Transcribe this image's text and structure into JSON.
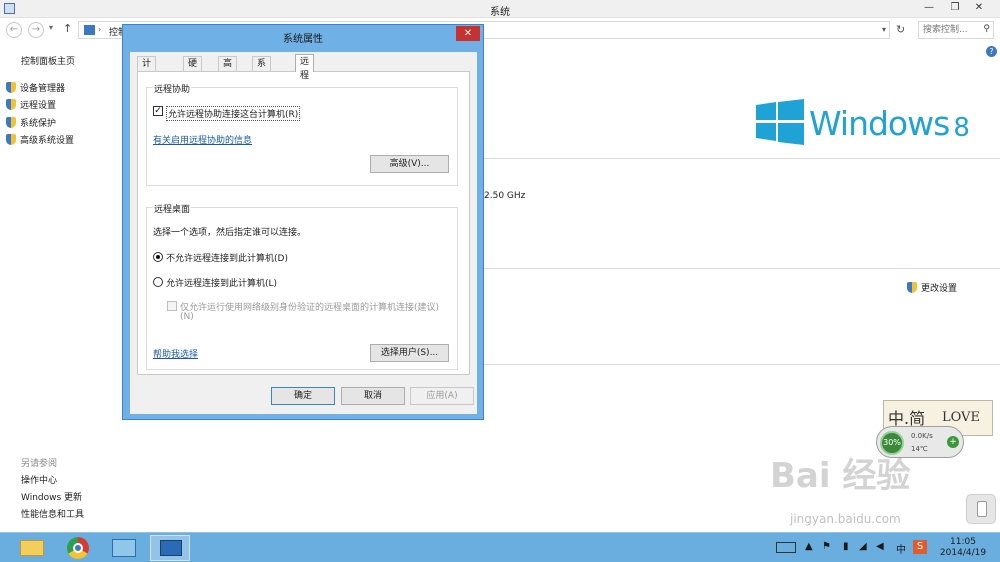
{
  "window": {
    "title": "系统",
    "address_crumb": "控制",
    "search_placeholder": "搜索控制..."
  },
  "left_nav": {
    "home": "控制面板主页",
    "items": [
      {
        "label": "设备管理器"
      },
      {
        "label": "远程设置"
      },
      {
        "label": "系统保护"
      },
      {
        "label": "高级系统设置"
      }
    ],
    "see_also_title": "另请参阅",
    "see_also": [
      {
        "label": "操作中心"
      },
      {
        "label": "Windows 更新"
      },
      {
        "label": "性能信息和工具"
      }
    ]
  },
  "content": {
    "logo_text": "Windows",
    "logo_version": "8",
    "cpu_speed": "2.50 GHz",
    "change_settings": "更改设置"
  },
  "dialog": {
    "title": "系统属性",
    "close_glyph": "✕",
    "tabs": [
      {
        "label": "计算机名"
      },
      {
        "label": "硬件"
      },
      {
        "label": "高级"
      },
      {
        "label": "系统保护"
      },
      {
        "label": "远程"
      }
    ],
    "active_tab": "远程",
    "remote_assistance": {
      "group_title": "远程协助",
      "allow_label": "允许远程协助连接这台计算机(R)",
      "allow_checked": true,
      "info_link": "有关启用远程协助的信息",
      "advanced_button": "高级(V)..."
    },
    "remote_desktop": {
      "group_title": "远程桌面",
      "instruction": "选择一个选项，然后指定谁可以连接。",
      "option_deny": "不允许远程连接到此计算机(D)",
      "option_allow": "允许远程连接到此计算机(L)",
      "selected": "deny",
      "nla_label_line1": "仅允许运行使用网络级别身份验证的远程桌面的计算机连接(建议)",
      "nla_label_line2": "(N)",
      "nla_checked": false,
      "help_link": "帮助我选择",
      "select_users_button": "选择用户(S)..."
    },
    "buttons": {
      "ok": "确定",
      "cancel": "取消",
      "apply": "应用(A)"
    }
  },
  "widget": {
    "brand_text": "中.简",
    "love_text": "LOVE",
    "percent": "30%",
    "net_speed": "0.0K/s",
    "temperature": "14℃"
  },
  "watermark": {
    "main": "Bai 经验",
    "url": "jingyan.baidu.com"
  },
  "taskbar": {
    "tray_ime": "中",
    "tray_s": "S",
    "clock_time": "11:05",
    "clock_date": "2014/4/19"
  },
  "colors": {
    "dialog_frame": "#6fb0e6",
    "close_red": "#c7312f",
    "link_blue": "#1a5aa8",
    "win8_logo": "#1fa2d6",
    "taskbar": "#6aaee0"
  }
}
